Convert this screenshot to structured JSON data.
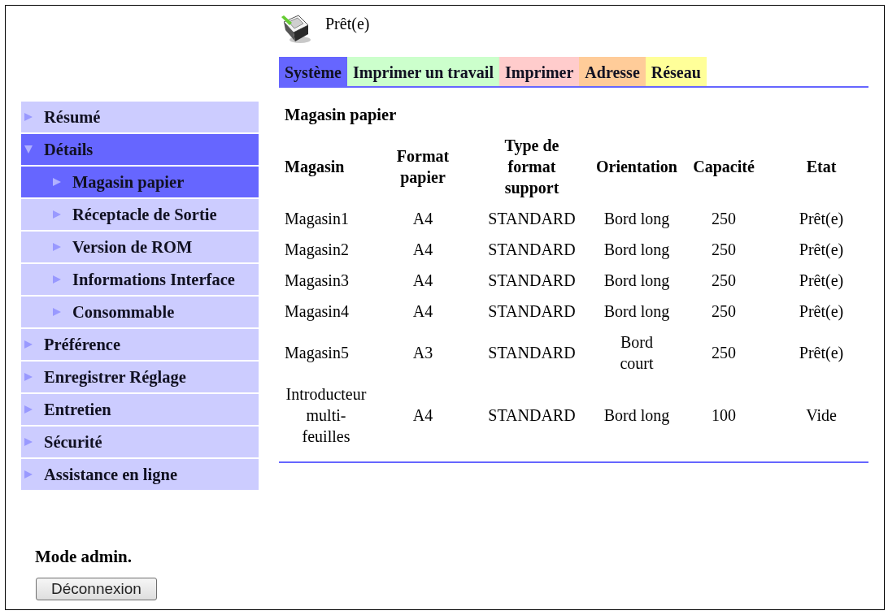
{
  "status": {
    "text": "Prêt(e)"
  },
  "tabs": [
    {
      "label": "Système",
      "color": "#6666ff",
      "selected": true
    },
    {
      "label": "Imprimer un travail",
      "color": "#ccffcc",
      "selected": false
    },
    {
      "label": "Imprimer",
      "color": "#ffcccc",
      "selected": false
    },
    {
      "label": "Adresse",
      "color": "#ffcc99",
      "selected": false
    },
    {
      "label": "Réseau",
      "color": "#ffff99",
      "selected": false
    }
  ],
  "sidebar": {
    "items": [
      {
        "label": "Résumé",
        "selected": false,
        "expanded": false
      },
      {
        "label": "Détails",
        "selected": true,
        "expanded": true,
        "children": [
          {
            "label": "Magasin papier",
            "selected": true
          },
          {
            "label": "Réceptacle de Sortie",
            "selected": false
          },
          {
            "label": "Version de ROM",
            "selected": false
          },
          {
            "label": "Informations Interface",
            "selected": false
          },
          {
            "label": "Consommable",
            "selected": false
          }
        ]
      },
      {
        "label": "Préférence",
        "selected": false,
        "expanded": false
      },
      {
        "label": "Enregistrer Réglage",
        "selected": false,
        "expanded": false
      },
      {
        "label": "Entretien",
        "selected": false,
        "expanded": false
      },
      {
        "label": "Sécurité",
        "selected": false,
        "expanded": false
      },
      {
        "label": "Assistance en ligne",
        "selected": false,
        "expanded": false
      }
    ]
  },
  "content": {
    "title": "Magasin papier",
    "table": {
      "columns": [
        "Magasin",
        "Format papier",
        "Type de format support",
        "Orientation",
        "Capacité",
        "Etat"
      ],
      "rows": [
        [
          "Magasin1",
          "A4",
          "STANDARD",
          "Bord long",
          "250",
          "Prêt(e)"
        ],
        [
          "Magasin2",
          "A4",
          "STANDARD",
          "Bord long",
          "250",
          "Prêt(e)"
        ],
        [
          "Magasin3",
          "A4",
          "STANDARD",
          "Bord long",
          "250",
          "Prêt(e)"
        ],
        [
          "Magasin4",
          "A4",
          "STANDARD",
          "Bord long",
          "250",
          "Prêt(e)"
        ],
        [
          "Magasin5",
          "A3",
          "STANDARD",
          "Bord court",
          "250",
          "Prêt(e)"
        ],
        [
          "Introducteur multi-feuilles",
          "A4",
          "STANDARD",
          "Bord long",
          "100",
          "Vide"
        ]
      ]
    }
  },
  "admin": {
    "label": "Mode admin.",
    "logout_button": "Déconnexion"
  }
}
